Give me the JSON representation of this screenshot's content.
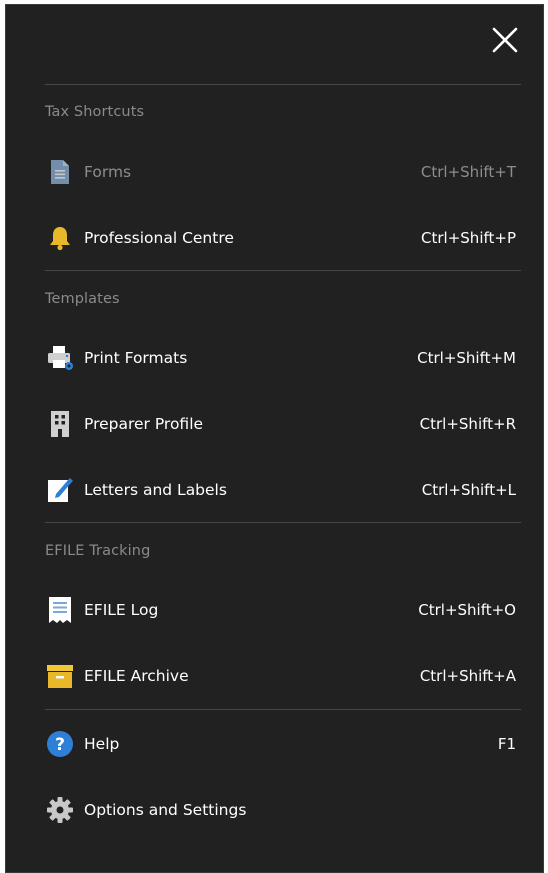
{
  "close": {
    "icon": "close-icon"
  },
  "sections": {
    "tax_shortcuts": {
      "header": "Tax Shortcuts",
      "forms": {
        "label": "Forms",
        "shortcut": "Ctrl+Shift+T",
        "icon": "document-icon",
        "enabled": false
      },
      "professional_centre": {
        "label": "Professional Centre",
        "shortcut": "Ctrl+Shift+P",
        "icon": "bell-icon"
      }
    },
    "templates": {
      "header": "Templates",
      "print_formats": {
        "label": "Print Formats",
        "shortcut": "Ctrl+Shift+M",
        "icon": "printer-icon"
      },
      "preparer_profile": {
        "label": "Preparer Profile",
        "shortcut": "Ctrl+Shift+R",
        "icon": "building-icon"
      },
      "letters_and_labels": {
        "label": "Letters and Labels",
        "shortcut": "Ctrl+Shift+L",
        "icon": "edit-icon"
      }
    },
    "efile_tracking": {
      "header": "EFILE Tracking",
      "efile_log": {
        "label": "EFILE Log",
        "shortcut": "Ctrl+Shift+O",
        "icon": "log-icon"
      },
      "efile_archive": {
        "label": "EFILE Archive",
        "shortcut": "Ctrl+Shift+A",
        "icon": "archive-icon"
      }
    },
    "general": {
      "help": {
        "label": "Help",
        "shortcut": "F1",
        "icon": "help-icon"
      },
      "options": {
        "label": "Options and Settings",
        "icon": "gear-icon"
      }
    }
  },
  "colors": {
    "background": "#212121",
    "text": "#ffffff",
    "muted": "#8a8a8a",
    "accent_blue": "#2e7fd6",
    "accent_yellow": "#e8b82a"
  }
}
